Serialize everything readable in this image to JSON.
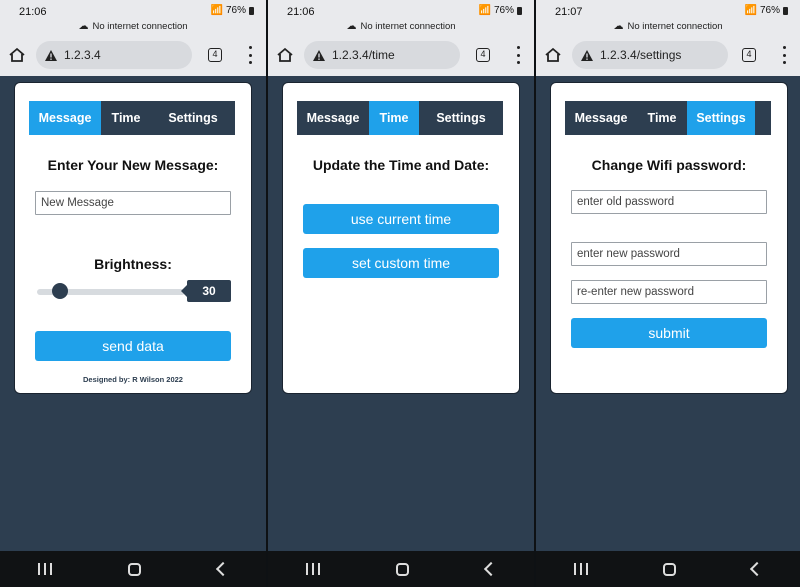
{
  "screens": [
    {
      "status": {
        "time": "21:06",
        "battery": "76%",
        "net": "No internet connection"
      },
      "url": "1.2.3.4",
      "tab_count": "4",
      "nav": [
        "Message",
        "Time",
        "Settings"
      ],
      "active_tab": 0,
      "heading": "Enter Your New Message:",
      "message_placeholder": "New Message",
      "brightness_label": "Brightness:",
      "brightness_value": "30",
      "send_label": "send data",
      "footer": "Designed by: R Wilson 2022"
    },
    {
      "status": {
        "time": "21:06",
        "battery": "76%",
        "net": "No internet connection"
      },
      "url": "1.2.3.4/time",
      "tab_count": "4",
      "nav": [
        "Message",
        "Time",
        "Settings"
      ],
      "active_tab": 1,
      "heading": "Update the Time and Date:",
      "btn_current": "use current time",
      "btn_custom": "set custom time"
    },
    {
      "status": {
        "time": "21:07",
        "battery": "76%",
        "net": "No internet connection"
      },
      "url": "1.2.3.4/settings",
      "tab_count": "4",
      "nav": [
        "Message",
        "Time",
        "Settings"
      ],
      "active_tab": 2,
      "heading": "Change Wifi password:",
      "old_placeholder": "enter old password",
      "new_placeholder": "enter new password",
      "reenter_placeholder": "re-enter new password",
      "submit_label": "submit"
    }
  ],
  "colors": {
    "accent": "#1fa1ea",
    "navy": "#2d3e50"
  }
}
